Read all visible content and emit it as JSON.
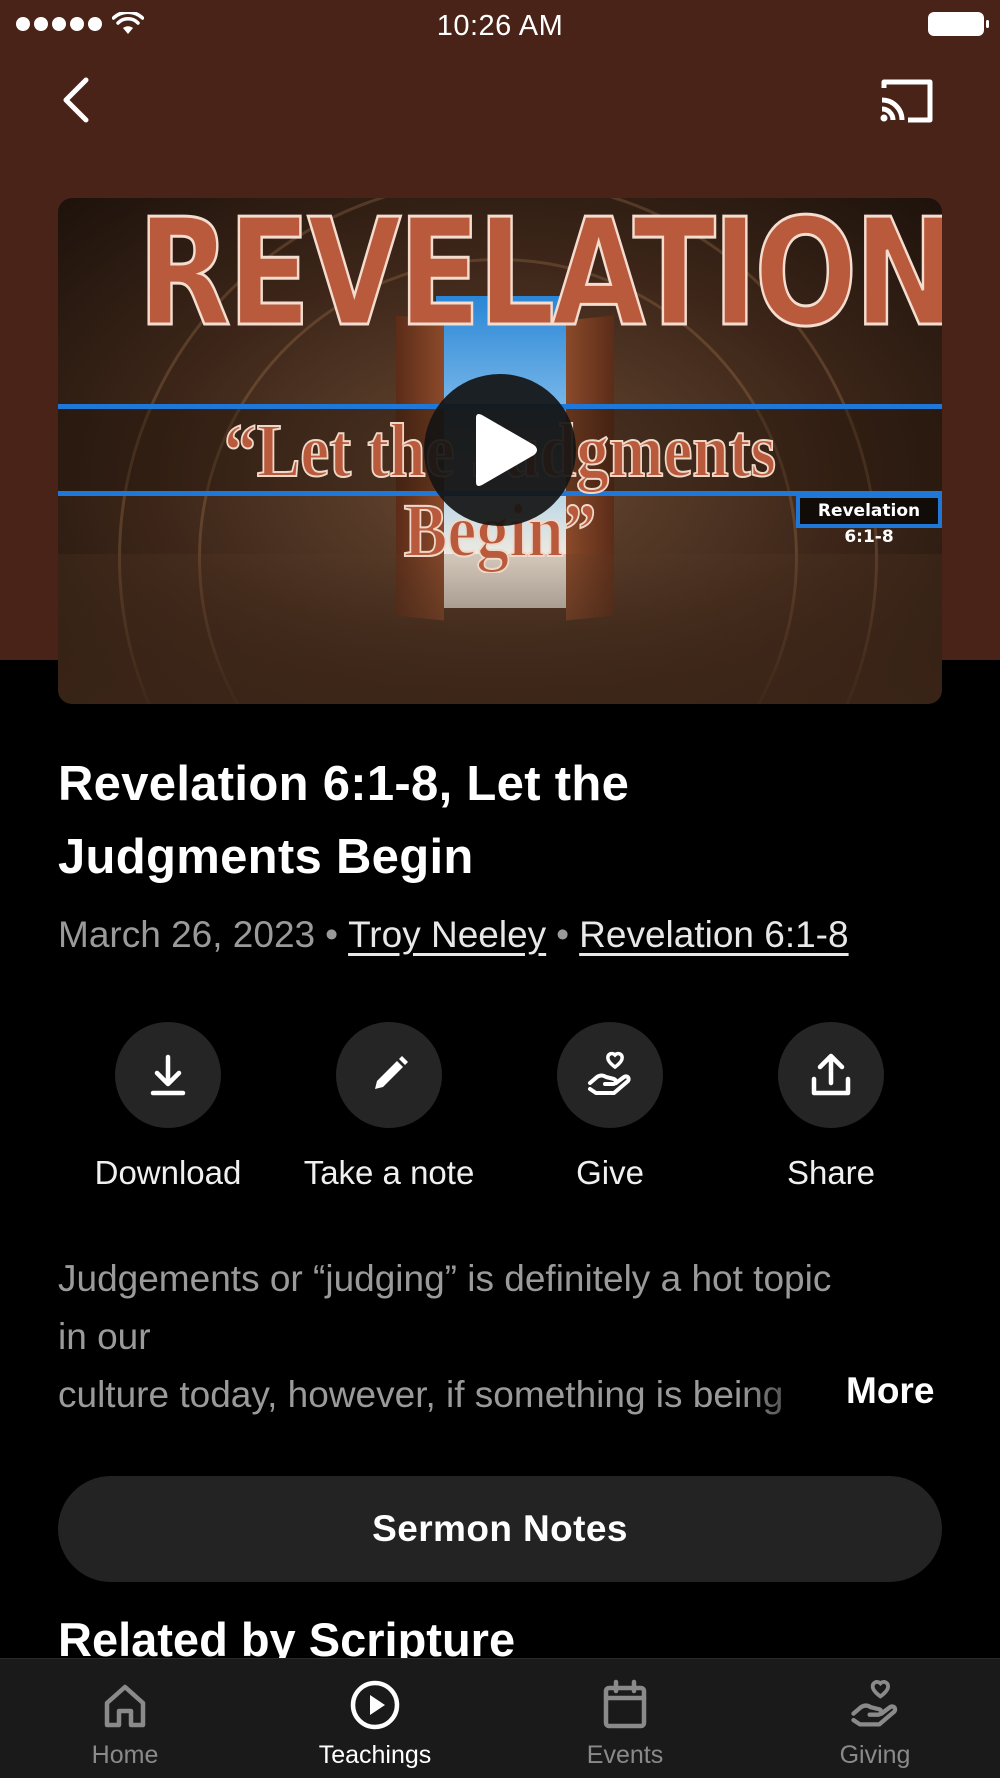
{
  "status_bar": {
    "time": "10:26 AM"
  },
  "nav": {
    "back_icon": "chevron-left-icon",
    "cast_icon": "cast-icon"
  },
  "video": {
    "title_art": "REVELATION",
    "subtitle_art": "“Let the Judgments Begin”",
    "scripture_tag": "Revelation 6:1-8",
    "play_icon": "play-icon"
  },
  "sermon": {
    "title": "Revelation 6:1-8, Let the Judgments Begin",
    "date": "March 26, 2023",
    "speaker": "Troy Neeley",
    "scripture": "Revelation 6:1-8"
  },
  "actions": [
    {
      "label": "Download",
      "icon": "download-icon"
    },
    {
      "label": "Take a note",
      "icon": "pencil-icon"
    },
    {
      "label": "Give",
      "icon": "give-hand-heart-icon"
    },
    {
      "label": "Share",
      "icon": "share-icon"
    }
  ],
  "description": {
    "line1": "Judgements or “judging” is definitely a hot topic",
    "line2": "in our",
    "line3": "culture today, however, if something is being",
    "more_label": "More"
  },
  "sermon_notes_label": "Sermon Notes",
  "related_heading": "Related by Scripture",
  "tabs": [
    {
      "label": "Home",
      "icon": "home-icon",
      "active": false
    },
    {
      "label": "Teachings",
      "icon": "play-circle-icon",
      "active": true
    },
    {
      "label": "Events",
      "icon": "calendar-icon",
      "active": false
    },
    {
      "label": "Giving",
      "icon": "give-hand-heart-icon",
      "active": false
    }
  ],
  "colors": {
    "header_bg": "#4a2318",
    "background": "#000000",
    "accent_blue": "#1f78d8",
    "button_bg": "#232323"
  }
}
